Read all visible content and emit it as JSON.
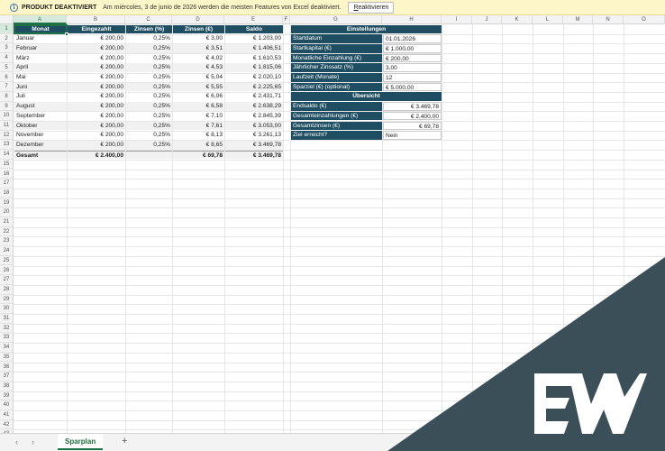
{
  "notification": {
    "title": "PRODUKT DEAKTIVIERT",
    "message": "Am miércoles, 3 de junio de 2026 werden die meisten Features von Excel deaktiviert.",
    "button_label": "Reaktivieren",
    "button_prefix": "R",
    "button_rest": "eaktivieren"
  },
  "columns": [
    "A",
    "B",
    "C",
    "D",
    "E",
    "F",
    "G",
    "H",
    "I",
    "J",
    "K",
    "L",
    "M",
    "N",
    "O"
  ],
  "rows": [
    "1",
    "2",
    "3",
    "4",
    "5",
    "6",
    "7",
    "8",
    "9",
    "10",
    "11",
    "12",
    "13",
    "14",
    "15",
    "16",
    "17",
    "18",
    "19",
    "20",
    "21",
    "22",
    "23",
    "24",
    "25",
    "26",
    "27",
    "28",
    "29",
    "30",
    "31",
    "32",
    "33",
    "34",
    "35",
    "36",
    "37",
    "38",
    "39",
    "40",
    "41",
    "42",
    "43"
  ],
  "table": {
    "headers": [
      "Monat",
      "Eingezahlt",
      "Zinsen (%)",
      "Zinsen (€)",
      "Saldo"
    ],
    "rows": [
      [
        "Januar",
        "€ 200,00",
        "0,25%",
        "€ 3,00",
        "€ 1.203,00"
      ],
      [
        "Februar",
        "€ 200,00",
        "0,25%",
        "€ 3,51",
        "€ 1.406,51"
      ],
      [
        "März",
        "€ 200,00",
        "0,25%",
        "€ 4,02",
        "€ 1.610,53"
      ],
      [
        "April",
        "€ 200,00",
        "0,25%",
        "€ 4,53",
        "€ 1.815,06"
      ],
      [
        "Mai",
        "€ 200,00",
        "0,25%",
        "€ 5,04",
        "€ 2.020,10"
      ],
      [
        "Juni",
        "€ 200,00",
        "0,25%",
        "€ 5,55",
        "€ 2.225,65"
      ],
      [
        "Juli",
        "€ 200,00",
        "0,25%",
        "€ 6,06",
        "€ 2.431,71"
      ],
      [
        "August",
        "€ 200,00",
        "0,25%",
        "€ 6,58",
        "€ 2.638,29"
      ],
      [
        "September",
        "€ 200,00",
        "0,25%",
        "€ 7,10",
        "€ 2.845,39"
      ],
      [
        "Oktober",
        "€ 200,00",
        "0,25%",
        "€ 7,61",
        "€ 3.053,00"
      ],
      [
        "November",
        "€ 200,00",
        "0,25%",
        "€ 8,13",
        "€ 3.261,13"
      ],
      [
        "Dezember",
        "€ 200,00",
        "0,25%",
        "€ 8,65",
        "€ 3.469,78"
      ]
    ],
    "total": [
      "Gesamt",
      "€ 2.400,00",
      "",
      "€ 69,78",
      "€ 3.469,78"
    ]
  },
  "settings": {
    "title": "Einstellungen",
    "items": [
      [
        "Startdatum",
        "01.01.2026"
      ],
      [
        "Startkapital (€)",
        "€ 1.000,00"
      ],
      [
        "Monatliche Einzahlung (€)",
        "€ 200,00"
      ],
      [
        "Jährlicher Zinssatz (%)",
        "3,00"
      ],
      [
        "Laufzeit (Monate)",
        "12"
      ],
      [
        "Sparziel (€) (optional)",
        "€ 5.000,00"
      ]
    ]
  },
  "overview": {
    "title": "Übersicht",
    "items": [
      [
        "Endsaldo (€)",
        "€ 3.469,78"
      ],
      [
        "Gesamteinzahlungen (€)",
        "€ 2.400,00"
      ],
      [
        "Gesamtzinsen (€)",
        "€ 69,78"
      ],
      [
        "Ziel erreicht?",
        "Nein"
      ]
    ]
  },
  "sheet_tab": "Sparplan",
  "add_sheet": "+",
  "nav_prev": "‹",
  "nav_next": "›",
  "colors": {
    "header": "#1f4e62",
    "accent": "#1e7145",
    "watermark": "#3b4f58"
  },
  "watermark_logo": "EW"
}
